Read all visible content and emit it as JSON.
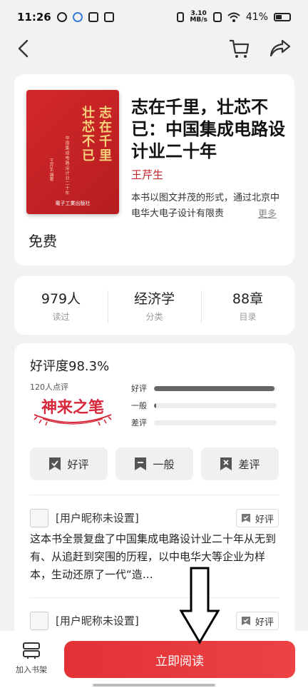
{
  "status_bar": {
    "time": "11:26",
    "net_speed_value": "3.10",
    "net_speed_unit": "MB/s",
    "battery": "41%"
  },
  "book": {
    "title": "志在千里，壮芯不已：中国集成电路设计业二十年",
    "author": "王芹生",
    "intro": "本书以图文并茂的形式，通过北京中电华大电子设计有限责",
    "more": "更多",
    "price": "免费",
    "cover": {
      "title_line1": "志在千里",
      "title_line2": "壮芯不已",
      "subtitle": "中国集成电路设计业二十年",
      "author": "王芹生 编著",
      "publisher": "電子工業出版社"
    }
  },
  "stats": [
    {
      "value": "979人",
      "label": "读过"
    },
    {
      "value": "经济学",
      "label": "分类"
    },
    {
      "value": "88章",
      "label": "目录"
    }
  ],
  "rating": {
    "title": "好评度98.3%",
    "count": "120人点评",
    "badge_text": "神来之笔",
    "bars": [
      {
        "label": "好评",
        "fraction": 0.983
      },
      {
        "label": "一般",
        "fraction": 0.017
      },
      {
        "label": "差评",
        "fraction": 0.0
      }
    ],
    "buttons": [
      "好评",
      "一般",
      "差评"
    ]
  },
  "reviews": [
    {
      "user": "[用户昵称未设置]",
      "tag": "好评",
      "text": "这本书全景复盘了中国集成电路设计业二十年从无到有、从追赶到突围的历程，以中电华大等企业为样本，生动还原了一代“造…"
    },
    {
      "user": "[用户昵称未设置]",
      "tag": "好评"
    }
  ],
  "bottom": {
    "shelf_label": "加入书架",
    "read_label": "立即阅读"
  },
  "colors": {
    "accent": "#e23236",
    "cover": "#c62226",
    "author": "#c0262d"
  }
}
